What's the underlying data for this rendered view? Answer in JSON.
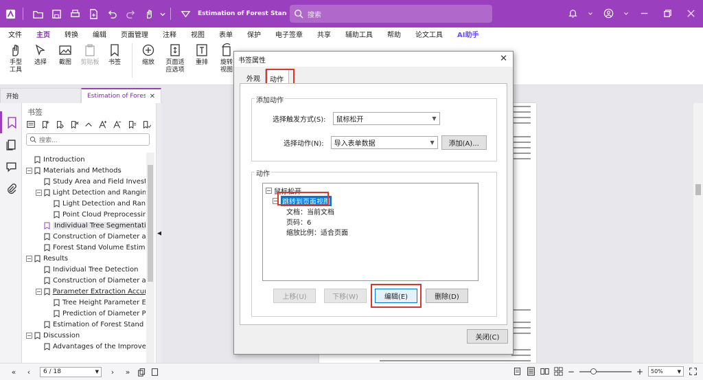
{
  "titlebar": {
    "doc_title": "Estimation of Forest Stand Vol...",
    "search_placeholder": "搜索"
  },
  "menu": [
    "文件",
    "主页",
    "转换",
    "编辑",
    "页面管理",
    "注释",
    "视图",
    "表单",
    "保护",
    "电子签章",
    "共享",
    "辅助工具",
    "帮助",
    "论文工具",
    "AI助手"
  ],
  "ribbon": {
    "hand": "手型\n工具",
    "select": "选择",
    "screenshot": "截图",
    "clipboard": "剪贴板",
    "bookmark": "书签",
    "zoom": "缩放",
    "fit_page": "页面适\n应选项",
    "reflow": "重排",
    "rotate": "旋转\n视图"
  },
  "tabs": {
    "start": "开始",
    "doc": "Estimation of Forest S..."
  },
  "bookmarks": {
    "heading": "书签",
    "search_placeholder": "搜索...",
    "items": [
      {
        "label": "Introduction"
      },
      {
        "label": "Materials and Methods"
      },
      {
        "label": "Study Area and Field Investigatio"
      },
      {
        "label": "Light Detection and Ranging (LiD"
      },
      {
        "label": "Light Detection and Ranging"
      },
      {
        "label": "Point Cloud Preprocessing"
      },
      {
        "label": "Individual Tree Segmentation"
      },
      {
        "label": "Construction of Diameter at Brea"
      },
      {
        "label": "Forest Stand Volume Estimation"
      },
      {
        "label": "Results"
      },
      {
        "label": "Individual Tree Detection"
      },
      {
        "label": "Construction of Diameter at Brea"
      },
      {
        "label": "Parameter Extraction Accuracy"
      },
      {
        "label": "Tree Height Parameter Extracti"
      },
      {
        "label": "Prediction of Diameter Param"
      },
      {
        "label": "Estimation of Forest Stand Volur"
      },
      {
        "label": "Discussion"
      },
      {
        "label": "Advantages of the Improved Ind"
      }
    ]
  },
  "status": {
    "page": "6 / 18",
    "zoom": "50%"
  },
  "dialog": {
    "title": "书签属性",
    "tab_appearance": "外观",
    "tab_action": "动作",
    "add_action_group": "添加动作",
    "trigger_label": "选择触发方式(S):",
    "trigger_value": "鼠标松开",
    "action_label": "选择动作(N):",
    "action_value": "导入表单数据",
    "add_button": "添加(A)...",
    "actions_group": "动作",
    "tree_root": "鼠标松开",
    "tree_child": "跳转到页面视图",
    "detail_doc": "文档：当前文档",
    "detail_page": "页码：6",
    "detail_zoom": "缩放比例：适合页面",
    "up_button": "上移(U)",
    "down_button": "下移(W)",
    "edit_button": "编辑(E)",
    "delete_button": "删除(D)",
    "close_button": "关闭(C)"
  },
  "colors": {
    "brand": "#9a3fbd",
    "highlight": "#e0332b",
    "selection": "#0078d7"
  }
}
